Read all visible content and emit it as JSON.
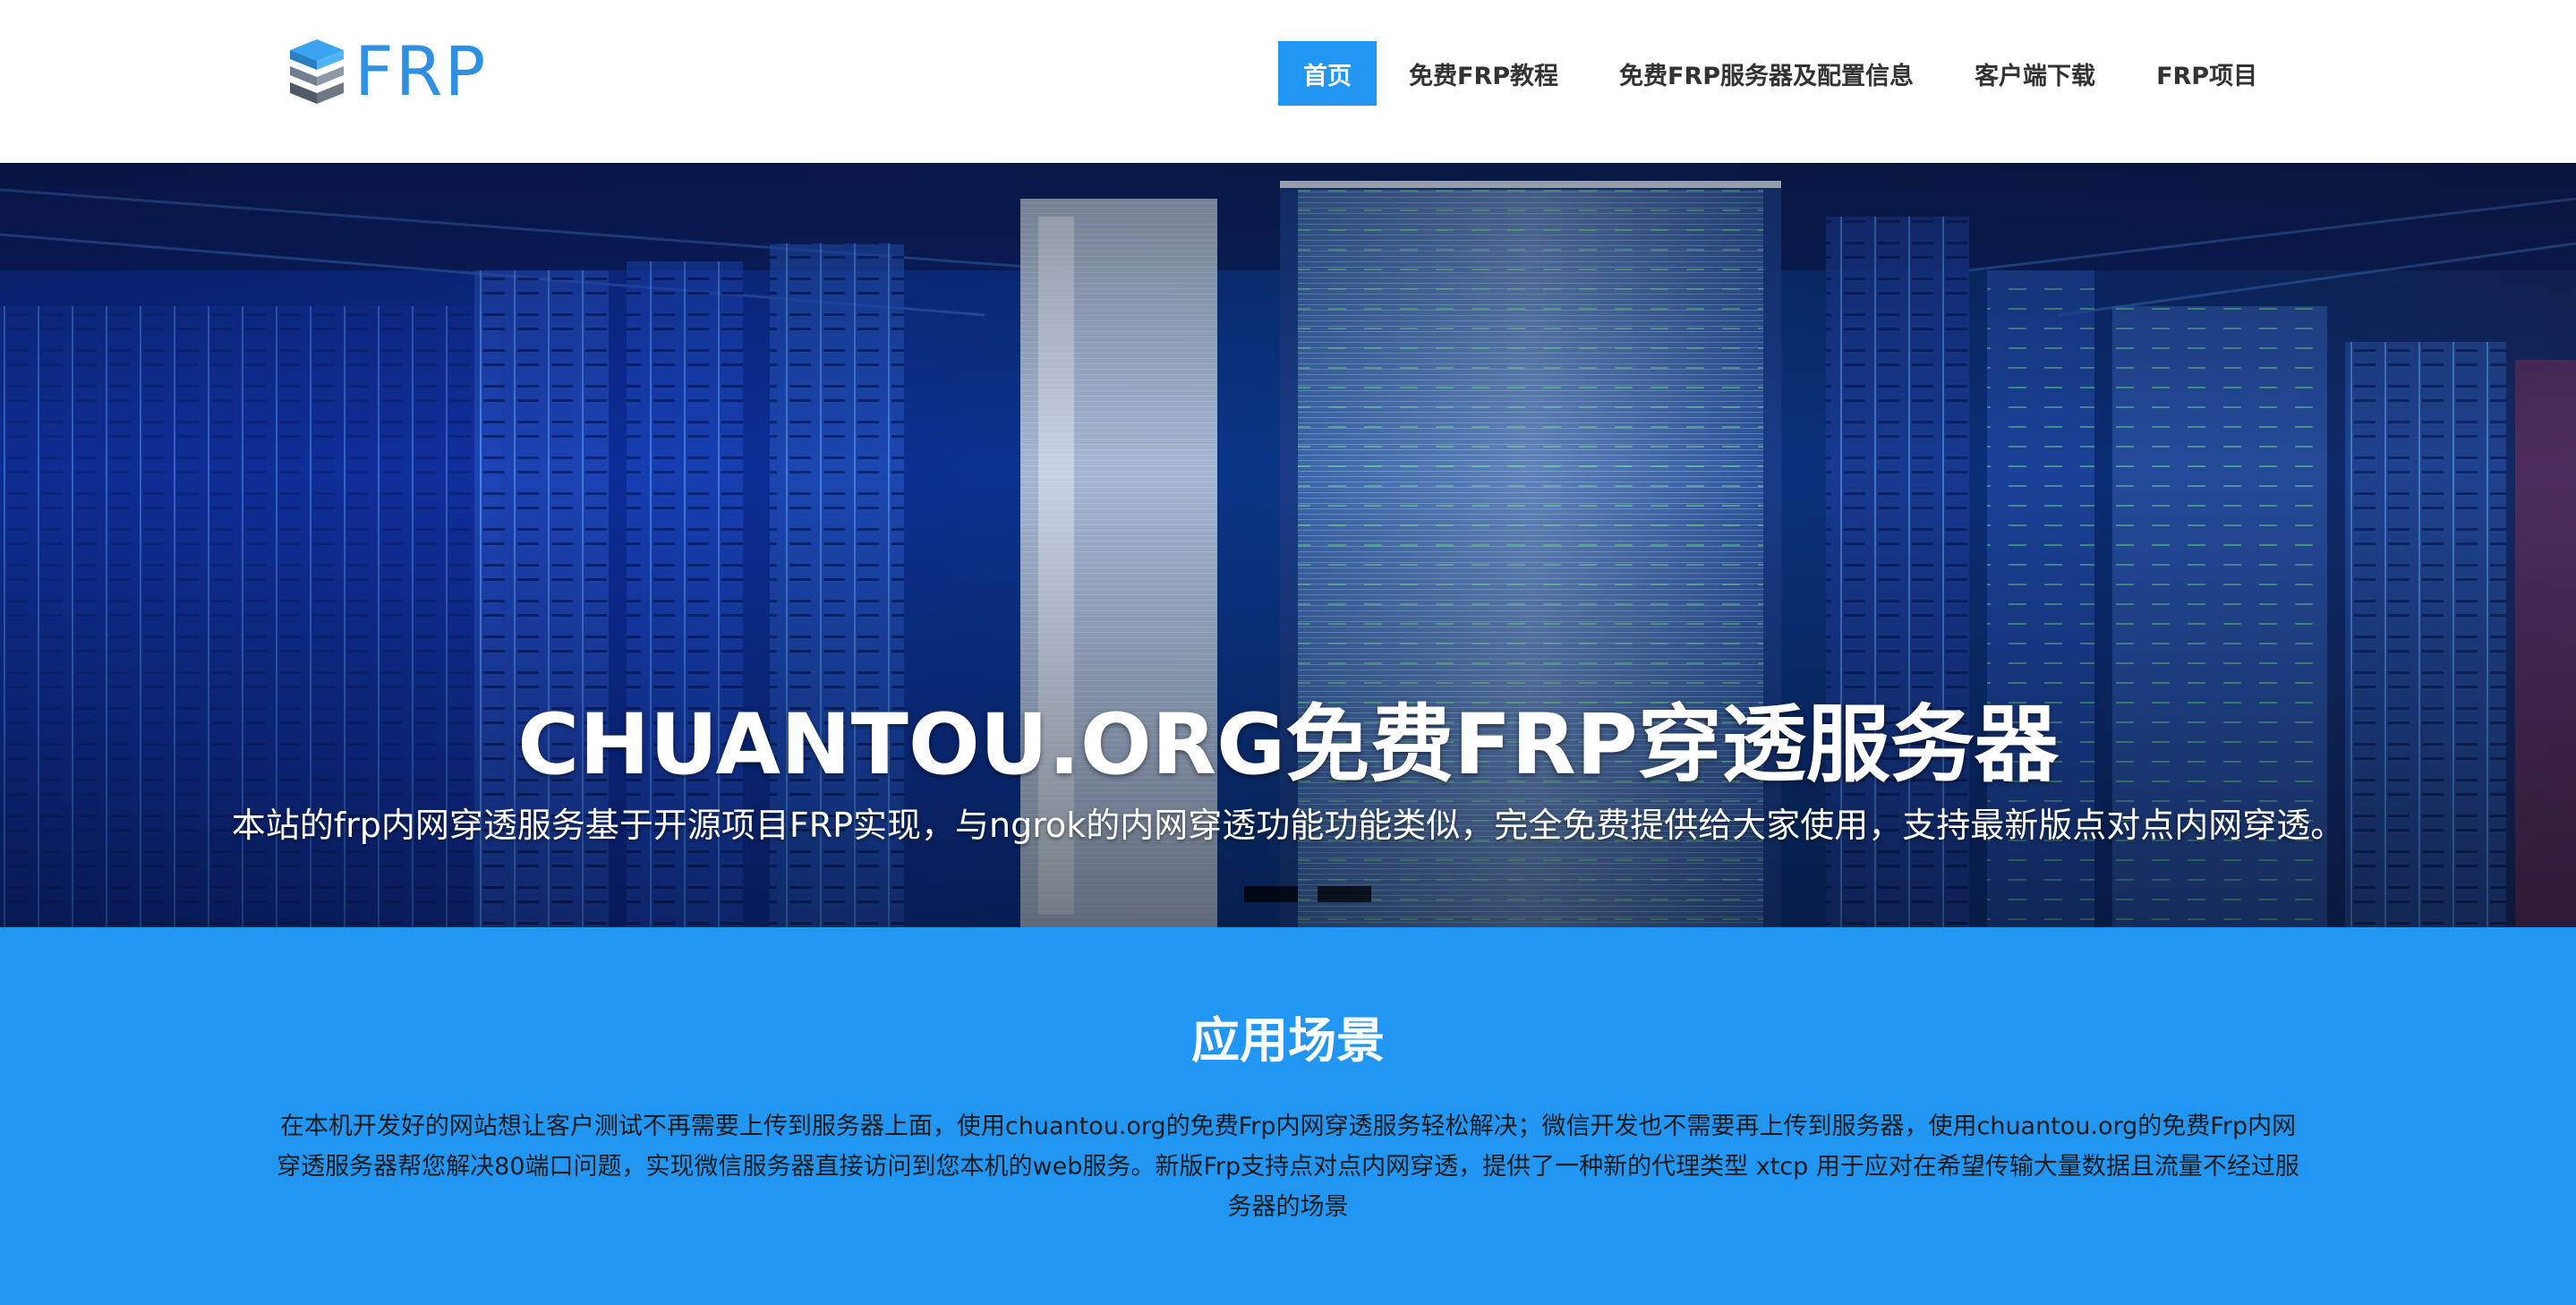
{
  "header": {
    "logo_text": "FRP",
    "nav": [
      {
        "label": "首页",
        "active": true
      },
      {
        "label": "免费FRP教程"
      },
      {
        "label": "免费FRP服务器及配置信息"
      },
      {
        "label": "客户端下载"
      },
      {
        "label": "FRP项目"
      }
    ]
  },
  "hero": {
    "title": "CHUANTOU.ORG免费FRP穿透服务器",
    "subtitle": "本站的frp内网穿透服务基于开源项目FRP实现，与ngrok的内网穿透功能功能类似，完全免费提供给大家使用，支持最新版点对点内网穿透。"
  },
  "scenario": {
    "title": "应用场景",
    "description": "在本机开发好的网站想让客户测试不再需要上传到服务器上面，使用chuantou.org的免费Frp内网穿透服务轻松解决；微信开发也不需要再上传到服务器，使用chuantou.org的免费Frp内网穿透服务器帮您解决80端口问题，实现微信服务器直接访问到您本机的web服务。新版Frp支持点对点内网穿透，提供了一种新的代理类型 xtcp 用于应对在希望传输大量数据且流量不经过服务器的场景"
  },
  "colors": {
    "accent": "#2196f3",
    "logo": "#2f8fe0",
    "hero_dark": "#071a5e"
  }
}
